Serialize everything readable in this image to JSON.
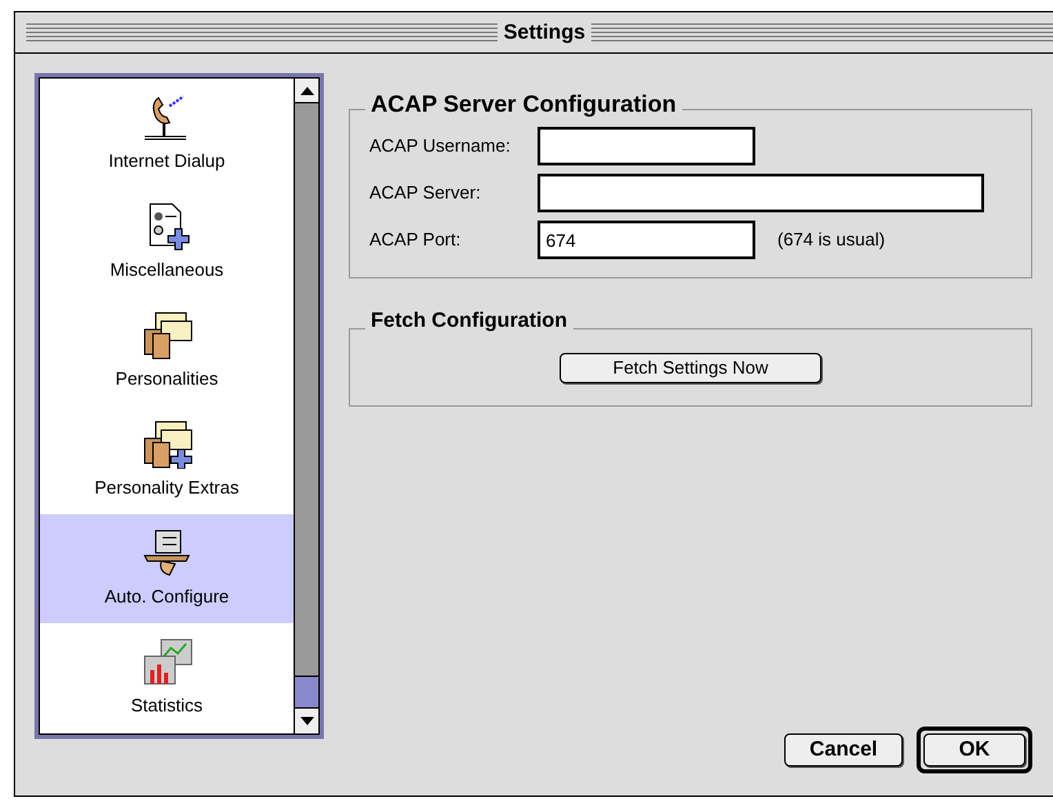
{
  "window": {
    "title": "Settings"
  },
  "sidebar": {
    "items": [
      {
        "label": "Internet Dialup",
        "selected": false
      },
      {
        "label": "Miscellaneous",
        "selected": false
      },
      {
        "label": "Personalities",
        "selected": false
      },
      {
        "label": "Personality Extras",
        "selected": false
      },
      {
        "label": "Auto. Configure",
        "selected": true
      },
      {
        "label": "Statistics",
        "selected": false
      }
    ]
  },
  "acap_group": {
    "title": "ACAP Server Configuration",
    "fields": [
      {
        "label": "ACAP Username:",
        "kind": "short"
      },
      {
        "label": "ACAP Server:",
        "kind": "long"
      },
      {
        "label": "ACAP Port:",
        "value": "674",
        "kind": "short",
        "note": "(674 is usual)"
      }
    ]
  },
  "fetch_group": {
    "title": "Fetch Configuration",
    "button": "Fetch Settings Now"
  },
  "buttons": [
    {
      "label": "Cancel",
      "default": false
    },
    {
      "label": "OK",
      "default": true
    }
  ]
}
